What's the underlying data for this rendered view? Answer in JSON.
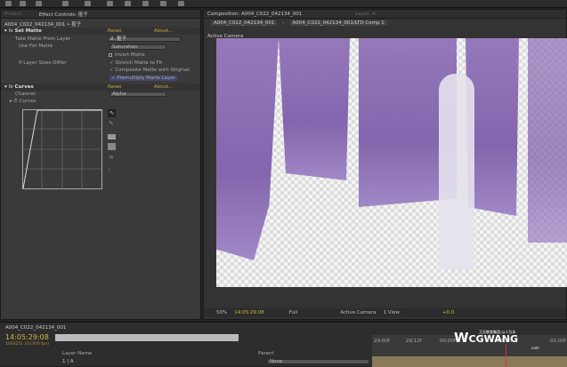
{
  "effect_controls": {
    "project_tab": "Project",
    "panel_tab": "Effect Controls: 抠子",
    "layer_path": "A004_C022_042134_001 • 抠子",
    "effects": [
      {
        "name": "Set Matte",
        "reset": "Reset",
        "about": "About..."
      },
      {
        "name": "Curves",
        "reset": "Reset",
        "about": "About..."
      }
    ],
    "set_matte": {
      "take_matte_label": "Take Matte From Layer",
      "take_matte_value": "2. 抠子",
      "use_for_matte_label": "Use For Matte",
      "use_for_matte_value": "Saturation",
      "invert": "Invert Matte",
      "if_sizes_differ": "If Layer Sizes Differ",
      "stretch": "Stretch Matte to Fit",
      "composite": "Composite Matte with Original",
      "premultiply": "Premultiply Matte Layer"
    },
    "curves": {
      "channel_label": "Channel:",
      "channel_value": "Alpha",
      "curves_label": "Curves"
    }
  },
  "composition": {
    "tab": "Composition: A004_C022_042134_001",
    "layer_tab": "Layer: A",
    "breadcrumb": [
      "A004_C022_042134_001",
      "A004_C022_042134_001/LTD Comp 1"
    ],
    "view_label": "Active Camera",
    "footer": {
      "zoom": "50%",
      "timecode": "14:05:29:08",
      "resolution": "Full",
      "camera": "Active Camera",
      "views": "1 View",
      "offset": "+0.0"
    }
  },
  "timeline": {
    "tab": "A004_C022_042134_001",
    "timecode": "14:05:29:08",
    "fps": "1000251 (23.976 fps)",
    "search_placeholder": "",
    "layer_name_header": "Layer Name",
    "parent_header": "Parent",
    "parent_value": "None",
    "layer_name": "1 | A",
    "ruler": [
      "29:00f",
      "29:12f",
      "00:00f",
      "00:12f",
      "01:00f"
    ]
  },
  "watermark": {
    "brand": "CGWANG",
    "tagline": "王氏教育集团,以人为本",
    "sub": ".com"
  }
}
